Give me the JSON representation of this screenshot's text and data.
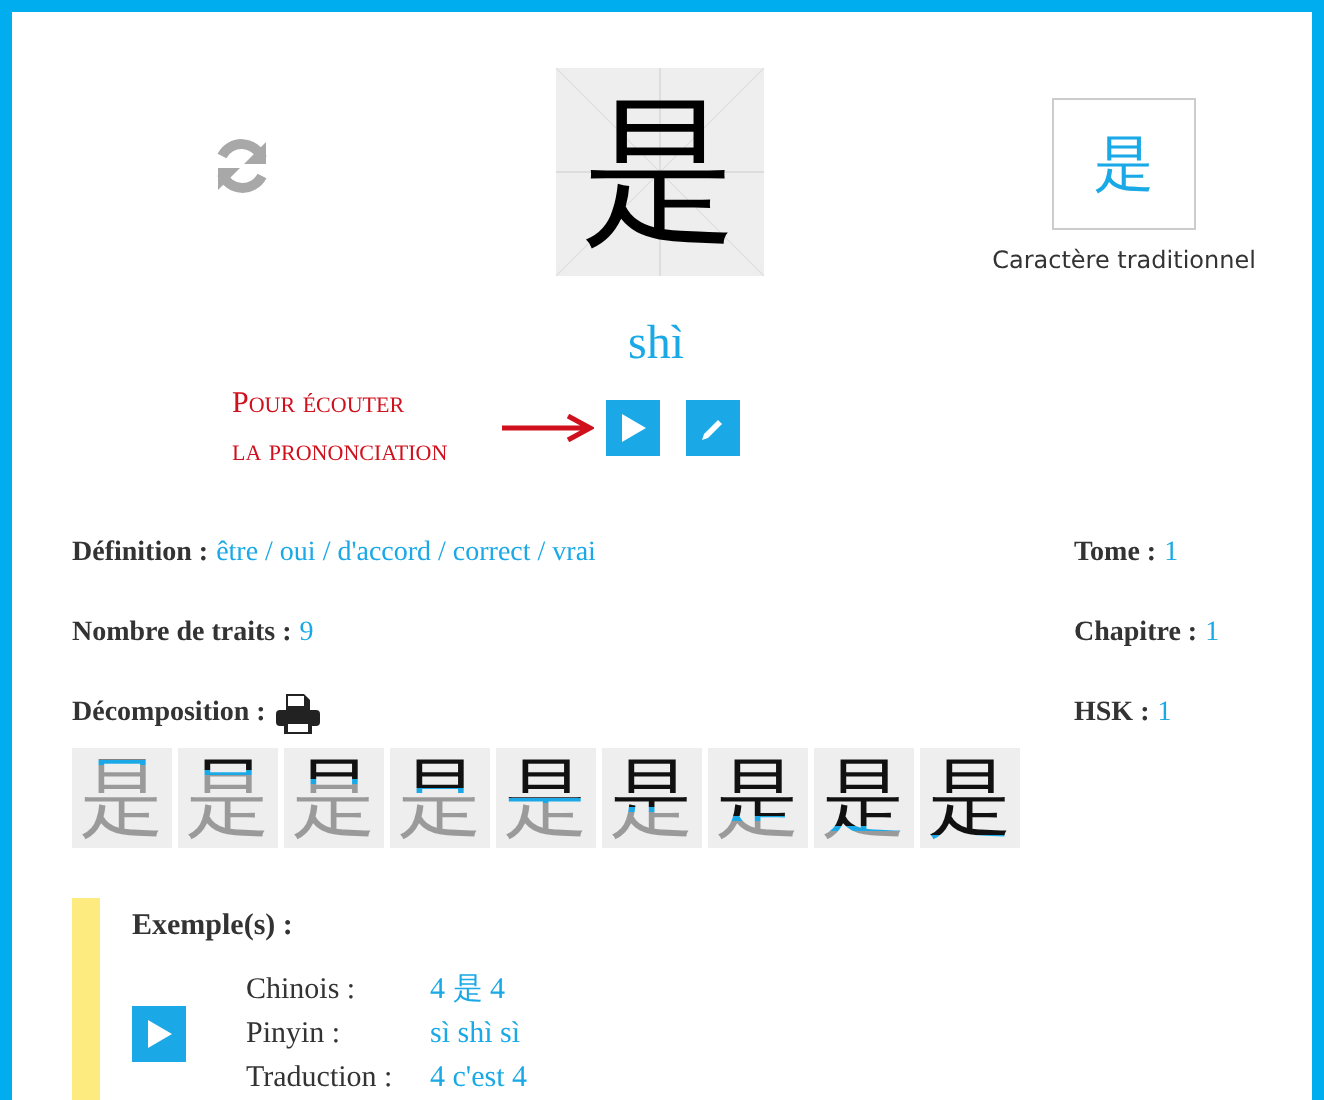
{
  "character": {
    "simplified": "是",
    "traditional": "是",
    "traditional_label": "Caractère traditionnel",
    "pinyin": "shì"
  },
  "annotation": {
    "lines": [
      "Pour écouter",
      "la prononciation"
    ]
  },
  "info_left": [
    {
      "label": "Définition :",
      "value": "être / oui / d'accord / correct / vrai",
      "kind": "text"
    },
    {
      "label": "Nombre de traits :",
      "value": "9",
      "kind": "text"
    },
    {
      "label": "Décomposition :",
      "kind": "print"
    }
  ],
  "info_right": [
    {
      "label": "Tome :",
      "value": "1"
    },
    {
      "label": "Chapitre :",
      "value": "1"
    },
    {
      "label": "HSK :",
      "value": "1"
    }
  ],
  "stroke_order": [
    {
      "character": "是"
    },
    {
      "character": "是"
    },
    {
      "character": "是"
    },
    {
      "character": "是"
    },
    {
      "character": "是"
    },
    {
      "character": "是"
    },
    {
      "character": "是"
    },
    {
      "character": "是"
    },
    {
      "character": "是"
    }
  ],
  "examples": {
    "title": "Exemple(s) :",
    "rows": [
      {
        "label": "Chinois :",
        "value": "4 是 4"
      },
      {
        "label": "Pinyin :",
        "value": "sì shì sì"
      },
      {
        "label": "Traduction :",
        "value": "4 c'est 4"
      }
    ]
  }
}
